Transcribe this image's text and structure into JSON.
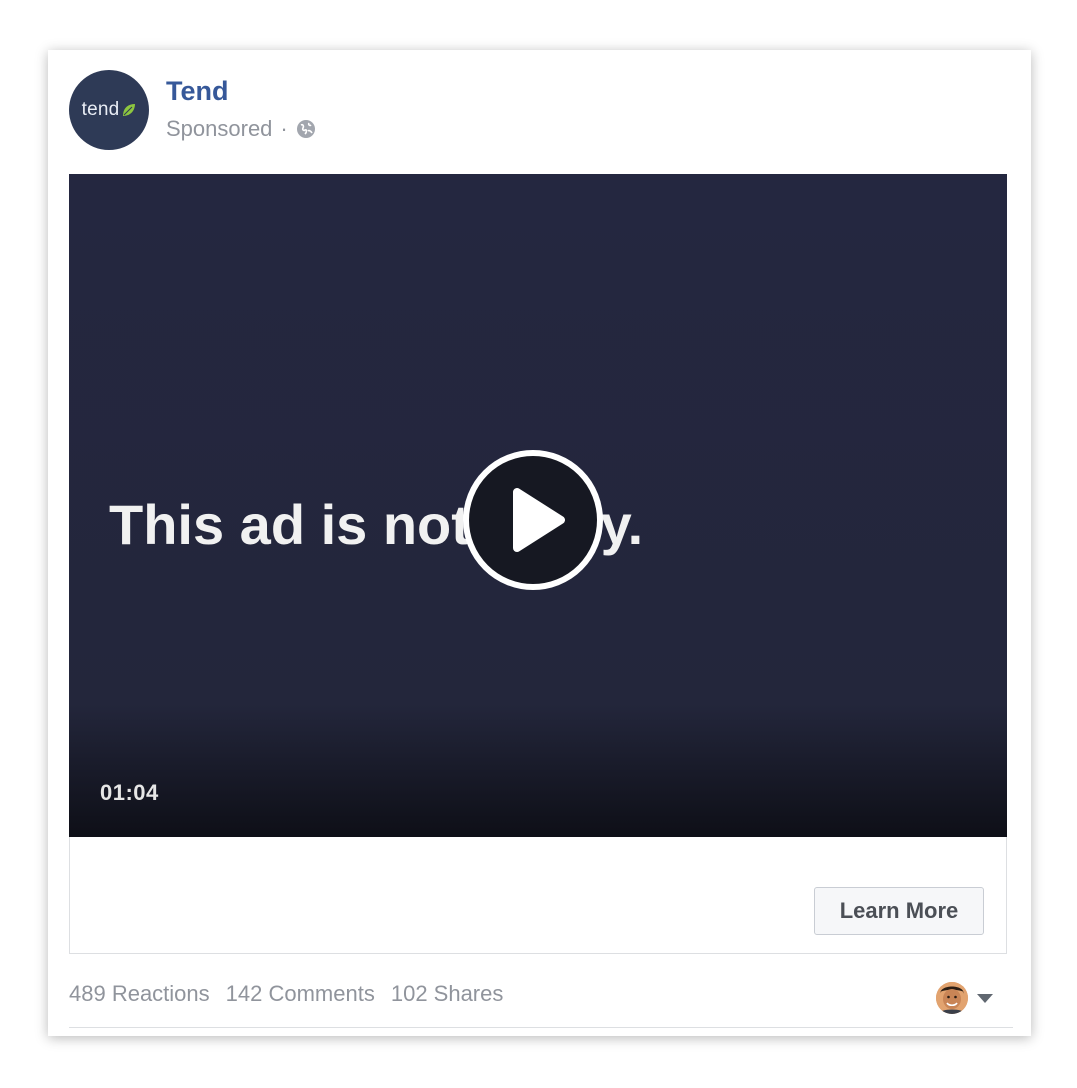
{
  "post": {
    "page_name": "Tend",
    "avatar_logo_text": "tend",
    "sponsored_label": "Sponsored",
    "separator": "·",
    "privacy_icon": "globe-icon"
  },
  "video": {
    "overlay_text": "This ad is not fancy.",
    "duration": "01:04",
    "play_icon": "play-icon"
  },
  "cta": {
    "label": "Learn More"
  },
  "stats": {
    "reactions": "489 Reactions",
    "comments": "142 Comments",
    "shares": "102 Shares"
  },
  "viewer": {
    "dropdown_icon": "caret-down-icon"
  },
  "colors": {
    "page_name": "#365899",
    "muted_text": "#90949c",
    "video_bg": "#23263b",
    "avatar_bg": "#2e3a56",
    "leaf_green": "#8dc63f"
  }
}
